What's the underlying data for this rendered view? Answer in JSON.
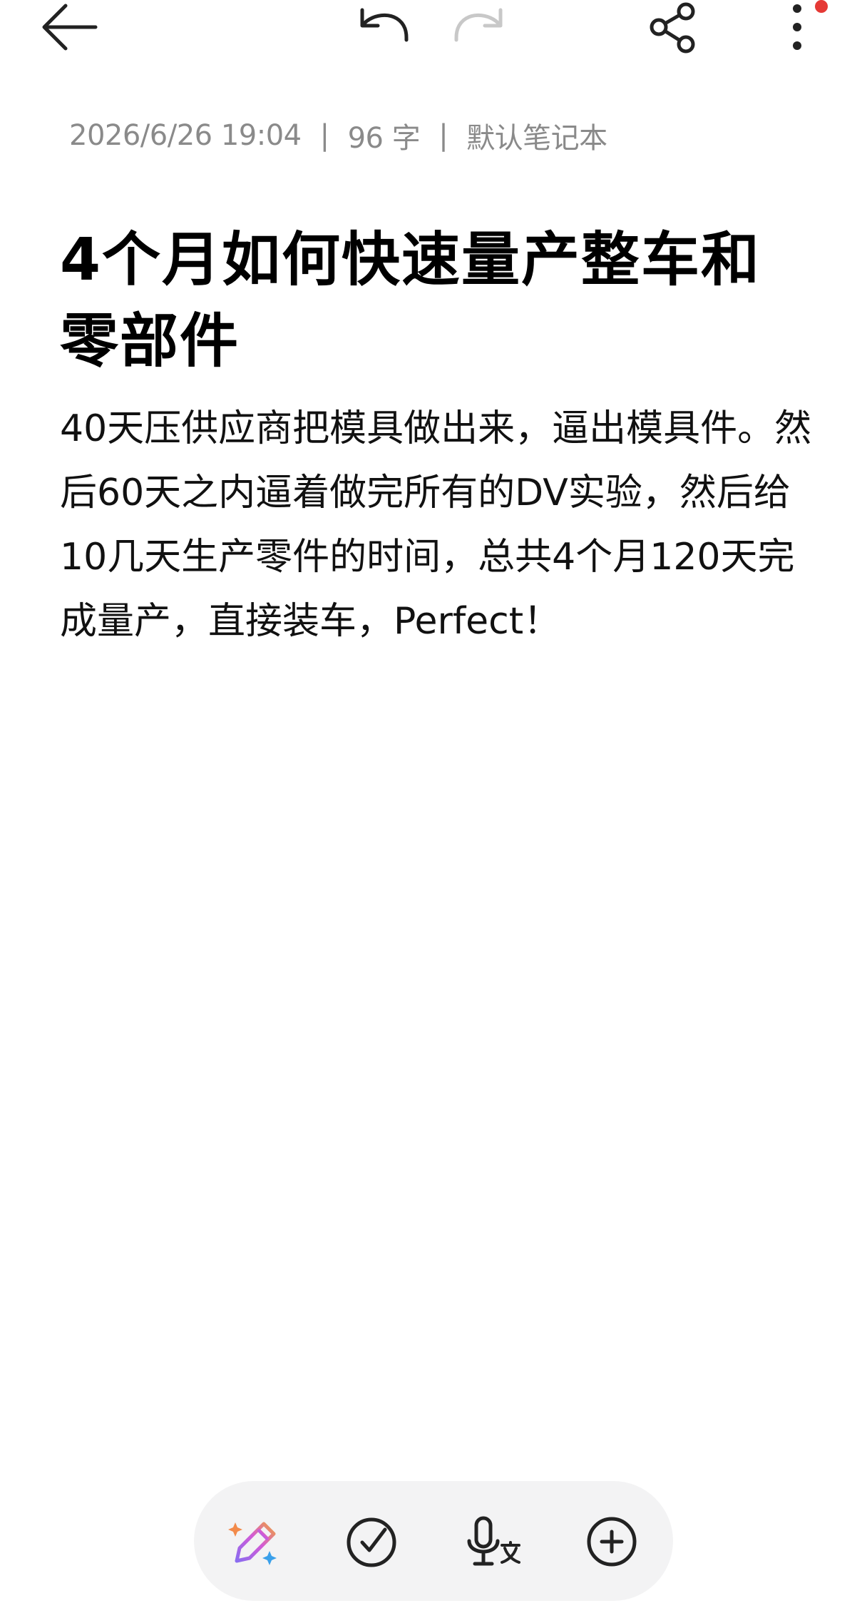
{
  "meta": {
    "datetime": "2026/6/26 19:04",
    "separator": "|",
    "word_count": "96 字",
    "notebook": "默认笔记本"
  },
  "note": {
    "title": "4个月如何快速量产整车和零部件",
    "body": "40天压供应商把模具做出来，逼出模具件。然后60天之内逼着做完所有的DV实验，然后给10几天生产零件的时间，总共4个月120天完成量产，直接装车，Perfect！"
  },
  "icons": {
    "back": "arrow-left-icon",
    "undo": "undo-icon",
    "redo": "redo-icon",
    "share": "share-icon",
    "more": "more-vertical-icon",
    "ai_pen": "ai-pen-icon",
    "checklist": "checklist-icon",
    "voice": "voice-to-text-icon",
    "add": "add-circle-icon"
  },
  "colors": {
    "notification_dot": "#e53935",
    "redo_disabled": "#c8c8c8",
    "toolbar_bg": "#f3f3f4"
  }
}
